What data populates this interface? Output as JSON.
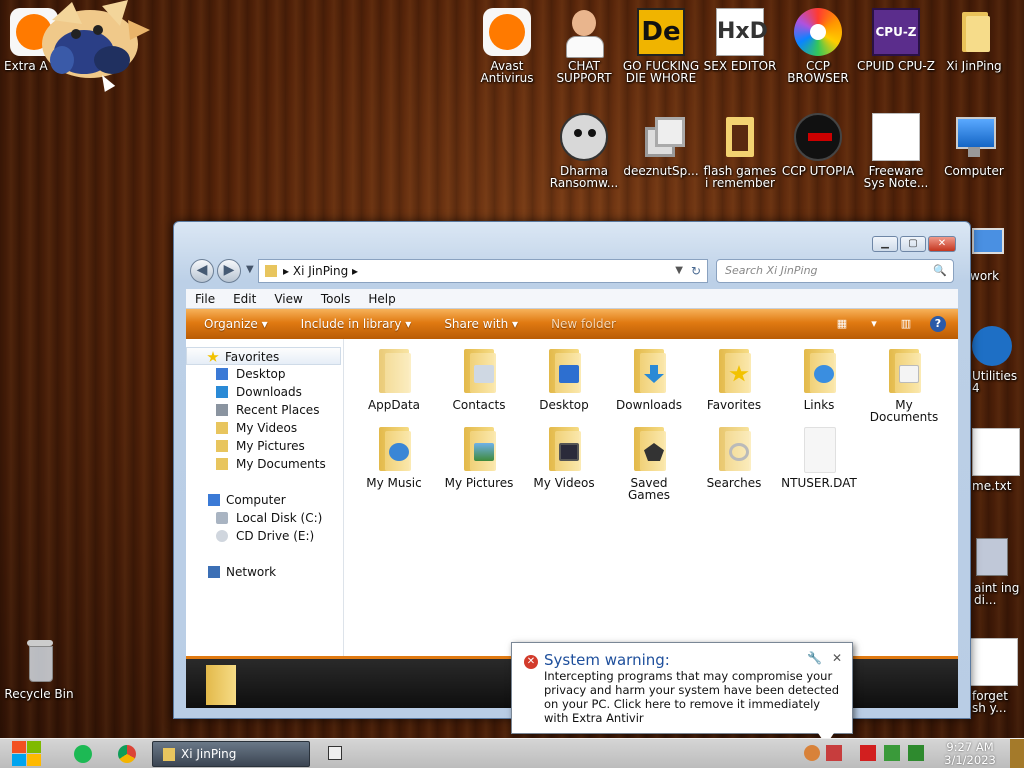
{
  "desktop": {
    "icons": [
      {
        "label": "Extra A",
        "icon": "extra-antivirus-icon"
      },
      {
        "label": "Avast Antivirus",
        "icon": "avast-icon"
      },
      {
        "label": "CHAT SUPPORT",
        "icon": "support-agent-icon"
      },
      {
        "label": "GO FUCKING DIE WHORE",
        "icon": "de-app-icon"
      },
      {
        "label": "SEX EDITOR",
        "icon": "hxd-icon"
      },
      {
        "label": "CCP BROWSER",
        "icon": "browser-icon"
      },
      {
        "label": "CPUID CPU-Z",
        "icon": "cpuz-icon"
      },
      {
        "label": "Xi JinPing",
        "icon": "user-folder-icon"
      },
      {
        "label": "Dharma Ransomw...",
        "icon": "skull-icon"
      },
      {
        "label": "deeznutSp...",
        "icon": "squares-icon"
      },
      {
        "label": "flash games i remember",
        "icon": "flash-folder-icon"
      },
      {
        "label": "CCP UTOPIA",
        "icon": "utopia-icon"
      },
      {
        "label": "Freeware Sys Note...",
        "icon": "document-icon"
      },
      {
        "label": "Computer",
        "icon": "computer-icon"
      },
      {
        "label": "Recycle Bin",
        "icon": "recycle-bin-icon"
      },
      {
        "label": "work",
        "icon": "network-icon"
      },
      {
        "label": "Utilities 4",
        "icon": "utilities-icon"
      },
      {
        "label": "me.txt",
        "icon": "text-file-icon"
      },
      {
        "label": "aint ing di...",
        "icon": "computer-icon"
      },
      {
        "label": "forget sh y...",
        "icon": "document-icon"
      }
    ]
  },
  "window": {
    "path": "Xi JinPing",
    "search_placeholder": "Search Xi JinPing",
    "controls": {
      "minimize": "▁",
      "maximize": "▢",
      "close": "✕"
    },
    "menu": [
      "File",
      "Edit",
      "View",
      "Tools",
      "Help"
    ],
    "commands": [
      "Organize",
      "Include in library",
      "Share with",
      "New folder"
    ],
    "nav": {
      "favorites": "Favorites",
      "favorites_items": [
        "Desktop",
        "Downloads",
        "Recent Places",
        "My Videos",
        "My Pictures",
        "My Documents"
      ],
      "computer": "Computer",
      "computer_items": [
        "Local Disk (C:)",
        "CD Drive (E:)"
      ],
      "network": "Network"
    },
    "files": [
      {
        "name": "AppData"
      },
      {
        "name": "Contacts"
      },
      {
        "name": "Desktop"
      },
      {
        "name": "Downloads"
      },
      {
        "name": "Favorites"
      },
      {
        "name": "Links"
      },
      {
        "name": "My Documents"
      },
      {
        "name": "My Music"
      },
      {
        "name": "My Pictures"
      },
      {
        "name": "My Videos"
      },
      {
        "name": "Saved Games"
      },
      {
        "name": "Searches"
      },
      {
        "name": "NTUSER.DAT"
      }
    ]
  },
  "notification": {
    "title": "System warning:",
    "message": "Intercepting programs that may compromise your privacy and harm your system have been detected on your PC. Click here to remove it immediately with Extra Antivir"
  },
  "taskbar": {
    "task_label": "Xi JinPing",
    "clock_time": "9:27 AM",
    "clock_date": "3/1/2023"
  },
  "colors": {
    "accent_orange": "#e07a12",
    "warning_red": "#d23b2b",
    "title_blue": "#1e4f9c"
  }
}
